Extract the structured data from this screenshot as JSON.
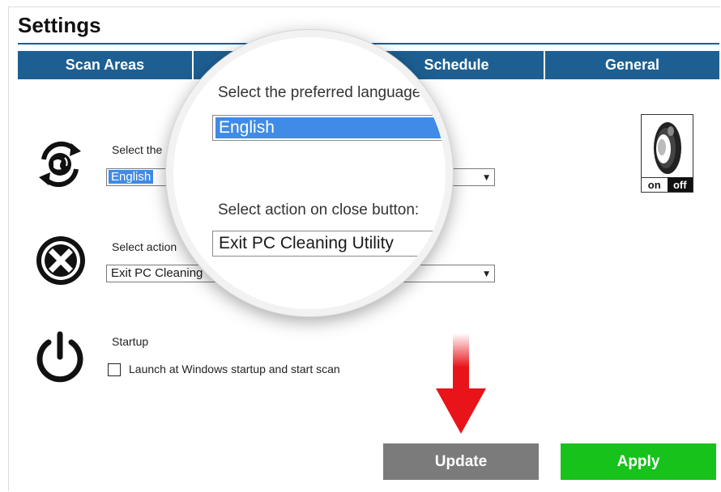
{
  "settings": {
    "title": "Settings",
    "tabs": [
      "Scan Areas",
      "",
      "Schedule",
      "General"
    ]
  },
  "language": {
    "label": "Select the preferred language:",
    "label_visible": "Select the",
    "value": "English"
  },
  "close_action": {
    "label": "Select action on close button:",
    "label_visible": "Select action",
    "value": "Exit PC Cleaning Utility",
    "value_visible": "Exit PC Cleaning"
  },
  "startup": {
    "label": "Startup",
    "checkbox_label": "Launch at Windows startup and start scan",
    "checked": false
  },
  "sound": {
    "on": "on",
    "off": "off"
  },
  "buttons": {
    "update": "Update",
    "apply": "Apply"
  },
  "colors": {
    "tab_blue": "#1d5f93",
    "highlight": "#3f8be6",
    "update_gray": "#7b7b7b",
    "apply_green": "#17c21a",
    "arrow_red": "#e8141a"
  },
  "icons": [
    "refresh-globe-icon",
    "close-circle-icon",
    "power-icon",
    "speaker-icon",
    "arrow-down-icon"
  ]
}
